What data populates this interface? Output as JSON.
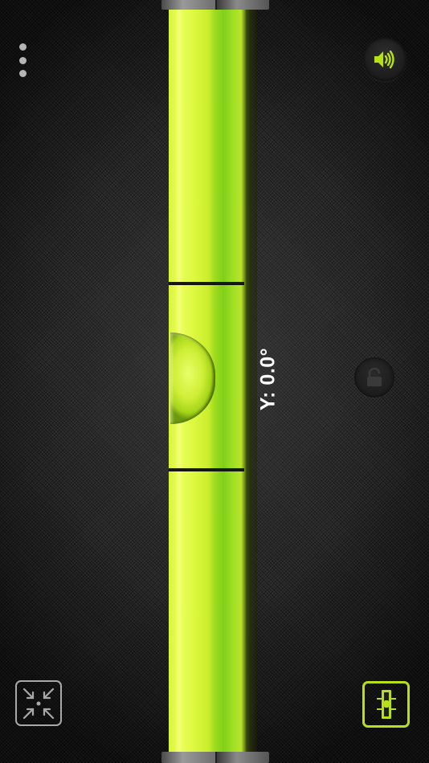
{
  "readout": {
    "text": "Y: 0.0°"
  },
  "icons": {
    "menu": "vertical-ellipsis",
    "sound": "speaker-volume",
    "lock": "padlock-unlocked",
    "calibrate": "arrows-inward-with-dot",
    "mode": "level-mode"
  },
  "colors": {
    "accent": "#b7df1a",
    "tube_light": "#eaff5a",
    "tube_dark": "#7fd01a",
    "icon_gray": "#b5b5b5"
  }
}
